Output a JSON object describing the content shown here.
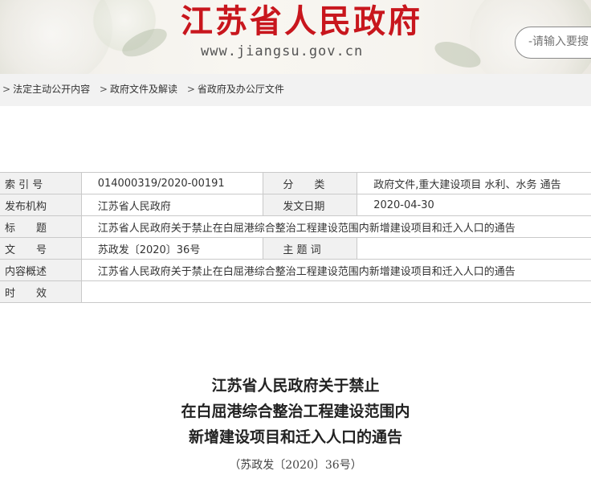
{
  "header": {
    "site_title": "江苏省人民政府",
    "site_url": "www.jiangsu.gov.cn",
    "search_placeholder": "-请输入要搜"
  },
  "breadcrumb": {
    "items": [
      "法定主动公开内容",
      "政府文件及解读",
      "省政府及办公厅文件"
    ]
  },
  "info": {
    "index_label": "索 引 号",
    "index_value": "014000319/2020-00191",
    "category_label": "分　　类",
    "category_value": "政府文件,重大建设项目 水利、水务 通告",
    "publisher_label": "发布机构",
    "publisher_value": "江苏省人民政府",
    "date_label": "发文日期",
    "date_value": "2020-04-30",
    "title_label": "标　　题",
    "title_value": "江苏省人民政府关于禁止在白屈港综合整治工程建设范围内新增建设项目和迁入人口的通告",
    "docno_label": "文　　号",
    "docno_value": "苏政发〔2020〕36号",
    "subject_label": "主 题 词",
    "subject_value": "",
    "summary_label": "内容概述",
    "summary_value": "江苏省人民政府关于禁止在白屈港综合整治工程建设范围内新增建设项目和迁入人口的通告",
    "validity_label": "时　　效",
    "validity_value": ""
  },
  "article": {
    "title_lines": [
      "江苏省人民政府关于禁止",
      "在白屈港综合整治工程建设范围内",
      "新增建设项目和迁入人口的通告"
    ],
    "doc_no": "（苏政发〔2020〕36号）"
  }
}
